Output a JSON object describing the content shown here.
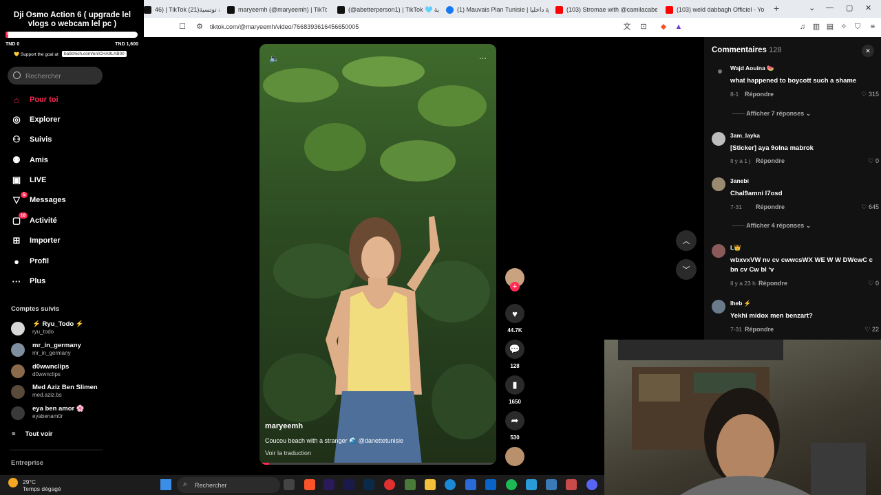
{
  "browser": {
    "tabs": [
      {
        "title": "46) | TikTok خلدونة توتسية(21)",
        "icon": "tiktok-icon"
      },
      {
        "title": "maryeemh (@maryeemh) | TikTok",
        "icon": "tiktok-icon"
      },
      {
        "title": "(@abetterperson1) | TikTok 🩵 اية",
        "icon": "tiktok-icon"
      },
      {
        "title": "(1) Mauvais Plan Tunisie | حيرة داخليا",
        "icon": "facebook-icon"
      },
      {
        "title": "(103) Stromae with @camilacabello",
        "icon": "youtube-icon"
      },
      {
        "title": "(103) weld dabbagh Officiel - YouTube",
        "icon": "youtube-icon"
      }
    ],
    "url": "tiktok.com/@maryeemh/video/7668393616456650005"
  },
  "overlay": {
    "title": "Dji Osmo Action 6 ( upgrade lel vlogs o webcam lel pc )",
    "progress_label": "0",
    "progress_fraction": 0.02,
    "start": "TND 0",
    "goal": "TND 1,600",
    "support_text": "💛 Support the goal at",
    "support_link": "ba9chich.com/en/CHA9LAB00"
  },
  "sidebar": {
    "search_placeholder": "Rechercher",
    "nav": [
      {
        "label": "Pour toi",
        "icon": "home-icon",
        "active": true
      },
      {
        "label": "Explorer",
        "icon": "compass-icon"
      },
      {
        "label": "Suivis",
        "icon": "following-icon"
      },
      {
        "label": "Amis",
        "icon": "friends-icon"
      },
      {
        "label": "LIVE",
        "icon": "live-icon"
      },
      {
        "label": "Messages",
        "icon": "messages-icon",
        "badge": "5"
      },
      {
        "label": "Activité",
        "icon": "activity-icon",
        "badge": "16"
      },
      {
        "label": "Importer",
        "icon": "upload-icon"
      },
      {
        "label": "Profil",
        "icon": "profile-icon"
      },
      {
        "label": "Plus",
        "icon": "more-icon"
      }
    ],
    "following_title": "Comptes suivis",
    "accounts": [
      {
        "name": "⚡ Ryu_Todo ⚡",
        "handle": "ryu_todo"
      },
      {
        "name": "mr_in_germany",
        "handle": "mr_in_germany"
      },
      {
        "name": "d0wwnclips",
        "handle": "d0wwnclips"
      },
      {
        "name": "Med Aziz Ben Slimen",
        "handle": "med.aziz.bs"
      },
      {
        "name": "eya ben amor 🌸",
        "handle": "eyabenam0r"
      }
    ],
    "see_all": "Tout voir",
    "company": "Entreprise"
  },
  "video": {
    "author": "maryeemh",
    "caption": "Coucou beach with a stranger 🌊 @danettetunisie",
    "translate": "Voir la traduction",
    "progress_fraction": 0.04
  },
  "actions": {
    "likes": "44.7K",
    "comments": "128",
    "saves": "1650",
    "shares": "530"
  },
  "comments_panel": {
    "title": "Commentaires",
    "count": "128",
    "reply_label": "Répondre",
    "comments": [
      {
        "user": "Wajd Aouina 🍉",
        "text": "what happened to boycott such a shame",
        "date": "8-1",
        "likes": "315"
      },
      {
        "user": "3am_layka",
        "text": "[Sticker] aya 9olna mabrok",
        "date": "Il y a 1 j",
        "likes": "0"
      },
      {
        "user": "3anebi",
        "text": "Chal9amni l7osd",
        "date": "7-31",
        "likes": "645"
      },
      {
        "user": "L👑",
        "text": "wbxvxVW nv cv cwwcsWX WE W W DWcwC c bn cv Cw bl ‘v",
        "date": "Il y a 23 h",
        "likes": "0"
      },
      {
        "user": "Iheb ⚡",
        "text": "Yekhi midox men benzart?",
        "date": "7-31",
        "likes": "22"
      }
    ],
    "more_replies": [
      "Afficher 7 réponses",
      "Afficher 4 réponses"
    ]
  },
  "taskbar": {
    "temp": "29°C",
    "weather": "Temps dégagé",
    "search": "Rechercher"
  },
  "colors": {
    "accent": "#fe2c55",
    "background": "#000000",
    "panel": "#121212"
  }
}
